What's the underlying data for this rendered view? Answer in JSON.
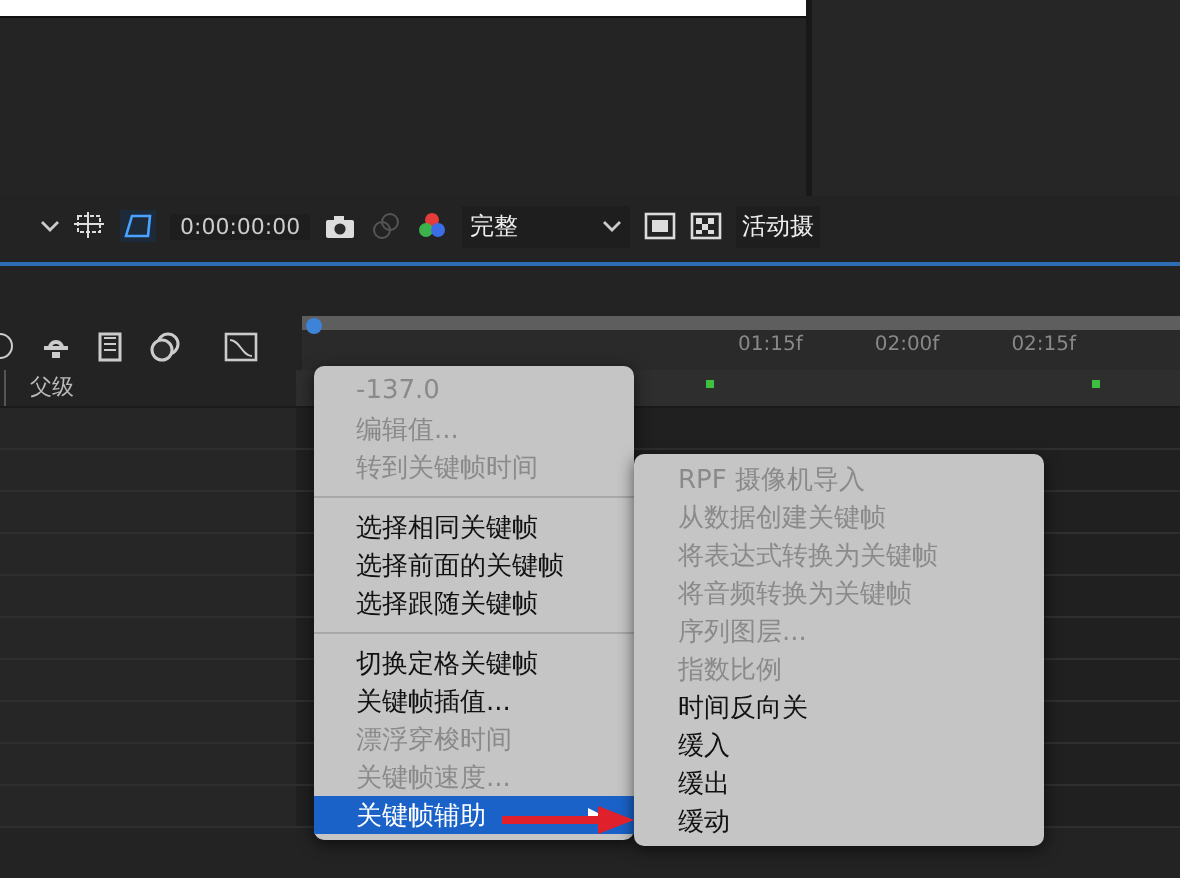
{
  "viewer_toolbar": {
    "timecode": "0:00:00:00",
    "resolution": "完整",
    "camera": "活动摄"
  },
  "timeline": {
    "ruler_labels": [
      "01:15f",
      "02:00f",
      "02:15f"
    ],
    "column_header": "父级"
  },
  "context_menu": {
    "groups": [
      [
        {
          "label": "-137.0",
          "disabled": true,
          "selected": false,
          "submenu": false
        },
        {
          "label": "编辑值...",
          "disabled": true,
          "selected": false,
          "submenu": false
        },
        {
          "label": "转到关键帧时间",
          "disabled": true,
          "selected": false,
          "submenu": false
        }
      ],
      [
        {
          "label": "选择相同关键帧",
          "disabled": false,
          "selected": false,
          "submenu": false
        },
        {
          "label": "选择前面的关键帧",
          "disabled": false,
          "selected": false,
          "submenu": false
        },
        {
          "label": "选择跟随关键帧",
          "disabled": false,
          "selected": false,
          "submenu": false
        }
      ],
      [
        {
          "label": "切换定格关键帧",
          "disabled": false,
          "selected": false,
          "submenu": false
        },
        {
          "label": "关键帧插值...",
          "disabled": false,
          "selected": false,
          "submenu": false
        },
        {
          "label": "漂浮穿梭时间",
          "disabled": true,
          "selected": false,
          "submenu": false
        },
        {
          "label": "关键帧速度...",
          "disabled": true,
          "selected": false,
          "submenu": false
        },
        {
          "label": "关键帧辅助",
          "disabled": false,
          "selected": true,
          "submenu": true
        }
      ]
    ]
  },
  "submenu": {
    "items": [
      {
        "label": "RPF 摄像机导入",
        "disabled": true
      },
      {
        "label": "从数据创建关键帧",
        "disabled": true
      },
      {
        "label": "将表达式转换为关键帧",
        "disabled": true
      },
      {
        "label": "将音频转换为关键帧",
        "disabled": true
      },
      {
        "label": "序列图层...",
        "disabled": true
      },
      {
        "label": "指数比例",
        "disabled": true
      },
      {
        "label": "时间反向关",
        "disabled": false
      },
      {
        "label": "缓入",
        "disabled": false
      },
      {
        "label": "缓出",
        "disabled": false
      },
      {
        "label": "缓动",
        "disabled": false
      }
    ]
  }
}
